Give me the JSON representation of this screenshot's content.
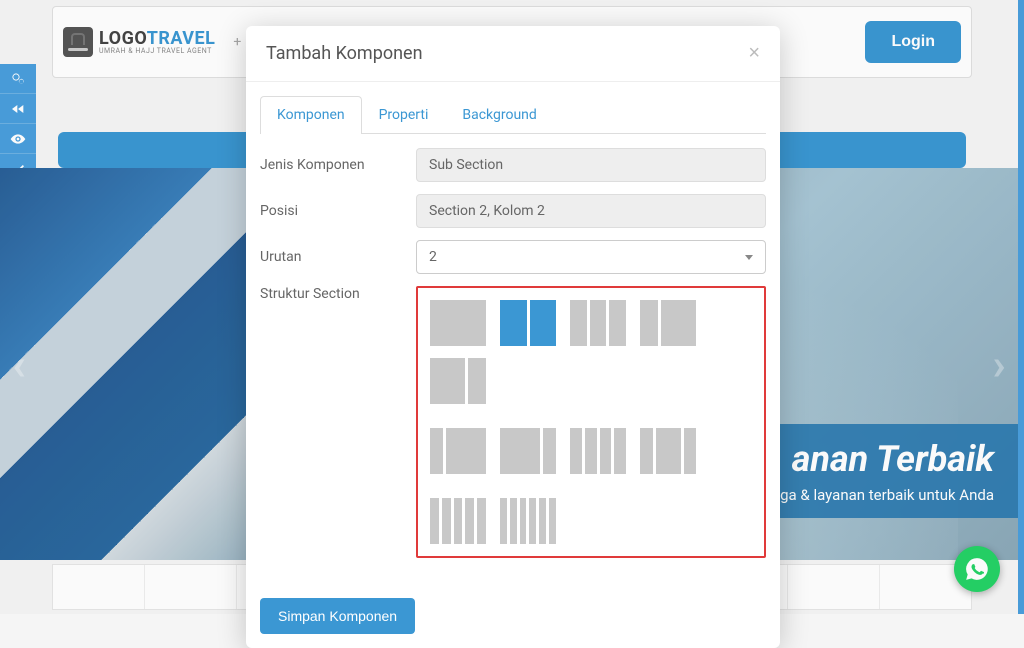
{
  "header": {
    "logo_line1_a": "LOGO",
    "logo_line1_b": "TRAVEL",
    "logo_line2": "UMRAH & HAJJ TRAVEL AGENT",
    "add_glyph": "+",
    "login": "Login"
  },
  "hero": {
    "arrow_left": "‹",
    "arrow_right": "›",
    "title": "anan Terbaik",
    "subtitle": "Garansi harga & layanan terbaik untuk Anda"
  },
  "strip": {
    "plus": "+"
  },
  "modal": {
    "title": "Tambah Komponen",
    "close": "×",
    "tabs": {
      "komponen": "Komponen",
      "properti": "Properti",
      "background": "Background"
    },
    "labels": {
      "jenis": "Jenis Komponen",
      "posisi": "Posisi",
      "urutan": "Urutan",
      "struktur": "Struktur Section"
    },
    "values": {
      "jenis": "Sub Section",
      "posisi": "Section 2, Kolom 2",
      "urutan": "2"
    },
    "layouts": [
      {
        "cols": [
          1
        ],
        "selected": false
      },
      {
        "cols": [
          1,
          1
        ],
        "selected": true
      },
      {
        "cols": [
          1,
          1,
          1
        ],
        "selected": false
      },
      {
        "cols": [
          1,
          2
        ],
        "selected": false
      },
      {
        "cols": [
          2,
          1
        ],
        "selected": false
      },
      {
        "cols": [
          1,
          3
        ],
        "selected": false
      },
      {
        "cols": [
          3,
          1
        ],
        "selected": false
      },
      {
        "cols": [
          1,
          1,
          1,
          1
        ],
        "selected": false
      },
      {
        "cols": [
          1,
          2,
          1
        ],
        "selected": false
      },
      {
        "cols": [
          1,
          1,
          1,
          1,
          1
        ],
        "selected": false
      },
      {
        "cols": [
          1,
          1,
          1,
          1,
          1,
          1
        ],
        "selected": false
      }
    ],
    "save": "Simpan Komponen"
  }
}
